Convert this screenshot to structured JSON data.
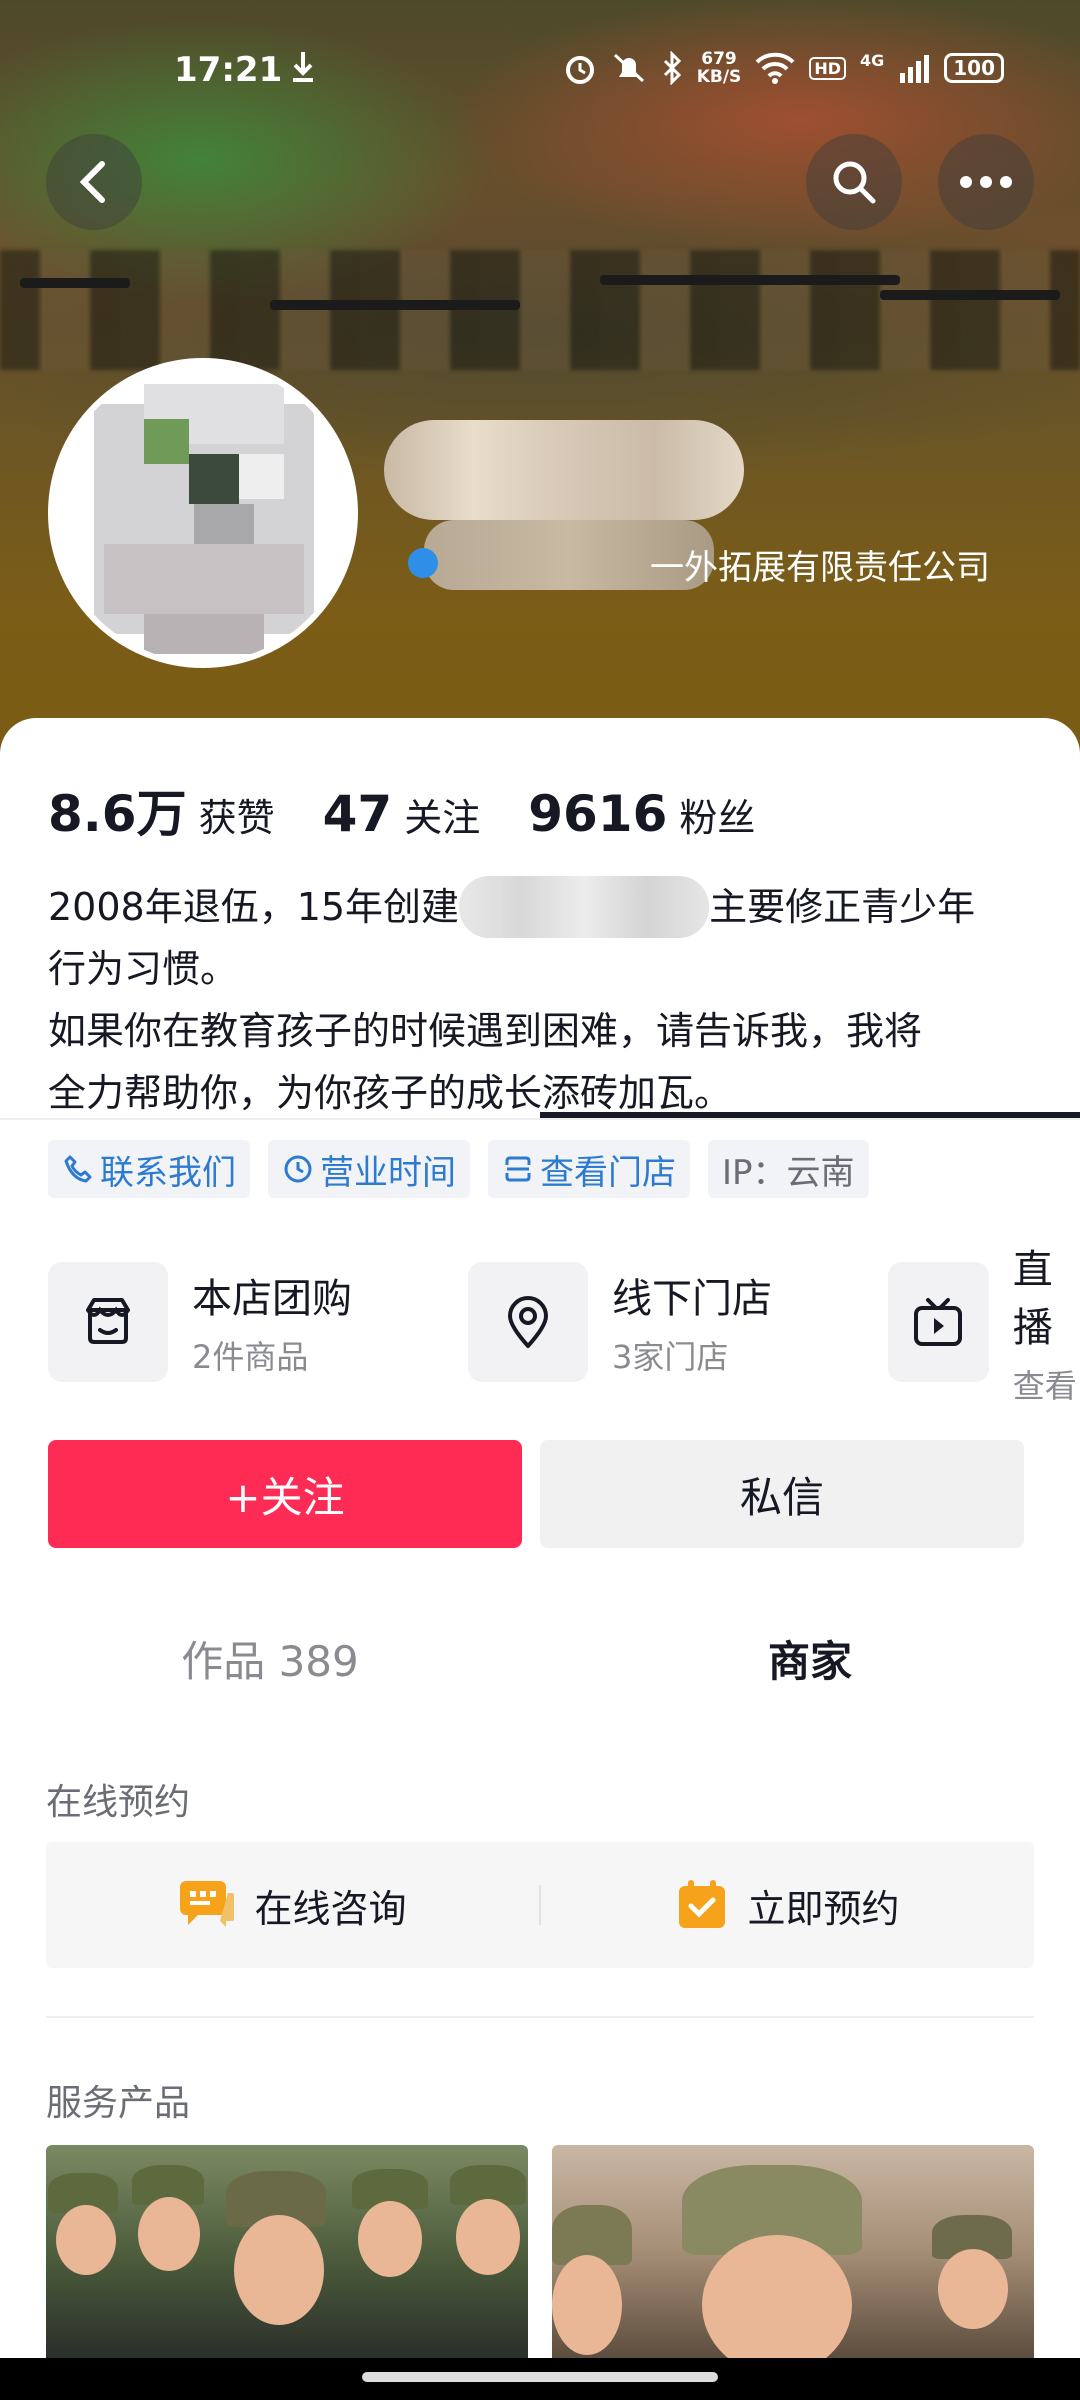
{
  "status_bar": {
    "time": "17:21",
    "speed_top": "679",
    "speed_bottom": "KB/S",
    "hd": "HD",
    "network": "4G",
    "battery": "100"
  },
  "header": {
    "company_suffix": "一外拓展有限责任公司"
  },
  "stats": [
    {
      "value": "8.6万",
      "label": "获赞"
    },
    {
      "value": "47",
      "label": "关注"
    },
    {
      "value": "9616",
      "label": "粉丝"
    }
  ],
  "bio": {
    "line1_pre": "2008年退伍，15年创建",
    "line1_post": "主要修正青少年",
    "line2": "行为习惯。",
    "line3": "如果你在教育孩子的时候遇到困难，请告诉我，我将",
    "line4": "全力帮助你，为你孩子的成长添砖加瓦。"
  },
  "tags": [
    {
      "label": "联系我们",
      "icon": "phone-icon"
    },
    {
      "label": "营业时间",
      "icon": "clock-icon"
    },
    {
      "label": "查看门店",
      "icon": "store-icon"
    },
    {
      "label": "IP：云南",
      "icon": ""
    }
  ],
  "services": [
    {
      "title": "本店团购",
      "sub": "2件商品",
      "icon": "shop-basket-icon"
    },
    {
      "title": "线下门店",
      "sub": "3家门店",
      "icon": "location-pin-icon"
    },
    {
      "title": "直播",
      "sub": "查看",
      "icon": "tv-icon"
    }
  ],
  "actions": {
    "follow": "+关注",
    "message": "私信"
  },
  "tabs": {
    "works": "作品 389",
    "merchant": "商家"
  },
  "online_booking": {
    "title": "在线预约",
    "consult": "在线咨询",
    "reserve": "立即预约"
  },
  "products": {
    "title": "服务产品"
  },
  "colors": {
    "primary": "#fe2c55",
    "link_blue": "#2c7bd0",
    "accent_orange": "#f7a21b"
  }
}
